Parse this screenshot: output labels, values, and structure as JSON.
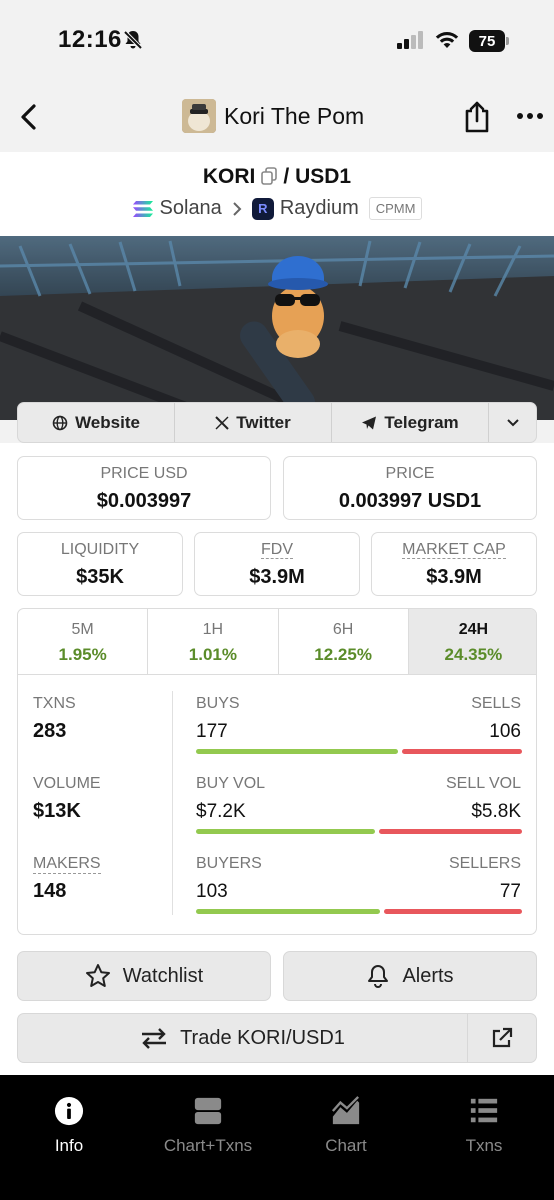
{
  "status_bar": {
    "time": "12:16",
    "battery": "75"
  },
  "header": {
    "title": "Kori The Pom"
  },
  "pair": {
    "base": "KORI",
    "separator": "/",
    "quote": "USD1",
    "chain": "Solana",
    "dex": "Raydium",
    "pool_type": "CPMM"
  },
  "links": {
    "website": "Website",
    "twitter": "Twitter",
    "telegram": "Telegram"
  },
  "stats": {
    "price_usd": {
      "label": "PRICE USD",
      "value": "$0.003997"
    },
    "price": {
      "label": "PRICE",
      "value": "0.003997 USD1"
    },
    "liquidity": {
      "label": "LIQUIDITY",
      "value": "$35K"
    },
    "fdv": {
      "label": "FDV",
      "value": "$3.9M"
    },
    "market_cap": {
      "label": "MARKET CAP",
      "value": "$3.9M"
    }
  },
  "timeframes": [
    {
      "label": "5M",
      "change": "1.95%"
    },
    {
      "label": "1H",
      "change": "1.01%"
    },
    {
      "label": "6H",
      "change": "12.25%"
    },
    {
      "label": "24H",
      "change": "24.35%",
      "active": true
    }
  ],
  "metrics": {
    "txns": {
      "label": "TXNS",
      "value": "283"
    },
    "volume": {
      "label": "VOLUME",
      "value": "$13K"
    },
    "makers": {
      "label": "MAKERS",
      "value": "148"
    }
  },
  "breakdown": {
    "buys": {
      "label": "BUYS",
      "value": "177",
      "ratio": 0.625
    },
    "sells": {
      "label": "SELLS",
      "value": "106"
    },
    "buy_vol": {
      "label": "BUY VOL",
      "value": "$7.2K",
      "ratio": 0.554
    },
    "sell_vol": {
      "label": "SELL VOL",
      "value": "$5.8K"
    },
    "buyers": {
      "label": "BUYERS",
      "value": "103",
      "ratio": 0.572
    },
    "sellers": {
      "label": "SELLERS",
      "value": "77"
    }
  },
  "actions": {
    "watchlist": "Watchlist",
    "alerts": "Alerts",
    "trade": "Trade KORI/USD1"
  },
  "tabs": [
    {
      "label": "Info",
      "icon": "info-icon",
      "active": true
    },
    {
      "label": "Chart+Txns",
      "icon": "chart-txns-icon"
    },
    {
      "label": "Chart",
      "icon": "chart-icon"
    },
    {
      "label": "Txns",
      "icon": "txns-icon"
    }
  ],
  "colors": {
    "positive": "#5b8c2a",
    "buy_bar": "#93c94f",
    "sell_bar": "#e8575c",
    "tab_bar": "#000000"
  }
}
